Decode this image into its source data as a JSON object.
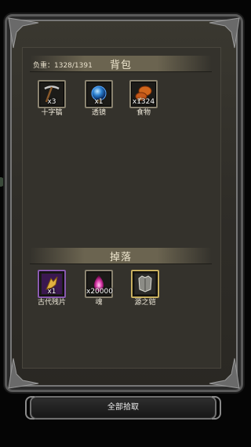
{
  "backpack": {
    "title": "背包",
    "weight_label": "负重：1328/1391",
    "items": [
      {
        "name": "十字镐",
        "qty": "x3",
        "icon": "pickaxe-icon"
      },
      {
        "name": "透镜",
        "qty": "x1",
        "icon": "lens-orb-icon"
      },
      {
        "name": "食物",
        "qty": "x1324",
        "icon": "food-icon"
      }
    ]
  },
  "drop": {
    "title": "掉落",
    "items": [
      {
        "name": "古代残片",
        "qty": "x1",
        "icon": "ancient-shard-icon"
      },
      {
        "name": "魂",
        "qty": "x20000",
        "icon": "soul-flame-icon"
      },
      {
        "name": "源之铠",
        "qty": "",
        "icon": "armor-icon"
      }
    ]
  },
  "pickup_all_label": "全部拾取",
  "colors": {
    "slot_border": "#8a8370",
    "purple_border": "#8a5ab0",
    "gold_border": "#c8b060"
  }
}
